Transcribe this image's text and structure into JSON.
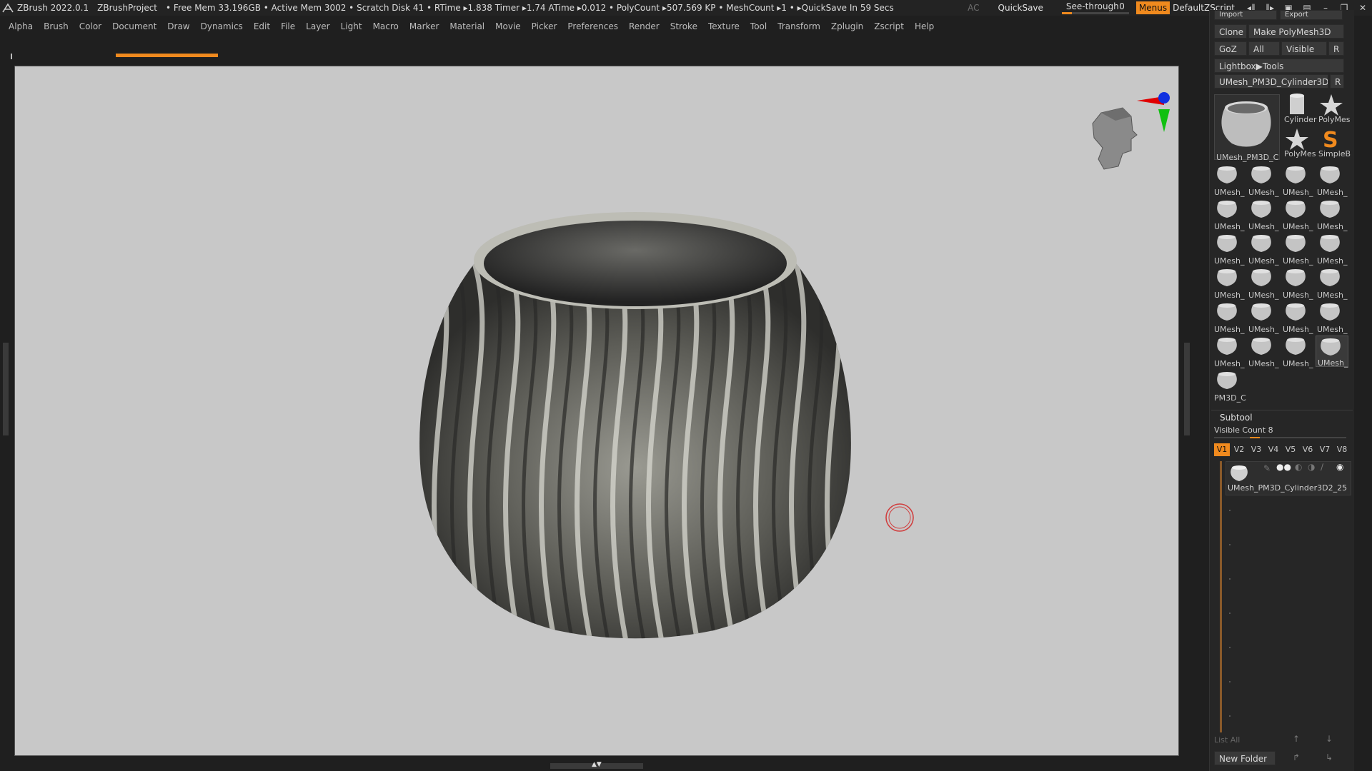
{
  "titlebar": {
    "app": "ZBrush 2022.0.1",
    "project": "ZBrushProject",
    "stats": "• Free Mem 33.196GB • Active Mem 3002 • Scratch Disk 41 • RTime ▸1.838 Timer ▸1.74 ATime ▸0.012 • PolyCount ▸507.569 KP • MeshCount ▸1 • ▸QuickSave In 59 Secs",
    "ac": "AC",
    "quicksave": "QuickSave",
    "see_through_label": "See-through",
    "see_through_value": "0",
    "see_through_fraction": 0.0,
    "menus": "Menus",
    "default_zscript": "DefaultZScript"
  },
  "menubar": [
    "Alpha",
    "Brush",
    "Color",
    "Document",
    "Draw",
    "Dynamics",
    "Edit",
    "File",
    "Layer",
    "Light",
    "Macro",
    "Marker",
    "Material",
    "Movie",
    "Picker",
    "Preferences",
    "Render",
    "Stroke",
    "Texture",
    "Tool",
    "Transform",
    "Zplugin",
    "Zscript",
    "Help"
  ],
  "colors": {
    "accent": "#f08a1e",
    "canvas": "#c8c8c8",
    "panel": "#262626"
  },
  "tool": {
    "import_label": "Import",
    "export_label": "Export",
    "clone": "Clone",
    "make_polymesh": "Make PolyMesh3D",
    "goz": "GoZ",
    "all": "All",
    "visible": "Visible",
    "r": "R",
    "lightbox_tools": "Lightbox▶Tools",
    "current_tool": "UMesh_PM3D_Cylinder3D2_25",
    "current_label": "UMesh_PM3D_C",
    "small_tools": [
      {
        "label": "Cylinder"
      },
      {
        "label": "PolyMes"
      },
      {
        "label": "PolyMes"
      },
      {
        "label": "SimpleB"
      }
    ],
    "thumb_label": "UMesh_",
    "thumb_last_label": "PM3D_C"
  },
  "subtool": {
    "header": "Subtool",
    "visible_count": "Visible Count 8",
    "tabs": [
      "V1",
      "V2",
      "V3",
      "V4",
      "V5",
      "V6",
      "V7",
      "V8"
    ],
    "item_label": "UMesh_PM3D_Cylinder3D2_25",
    "list_all": "List All",
    "new_folder": "New Folder"
  }
}
